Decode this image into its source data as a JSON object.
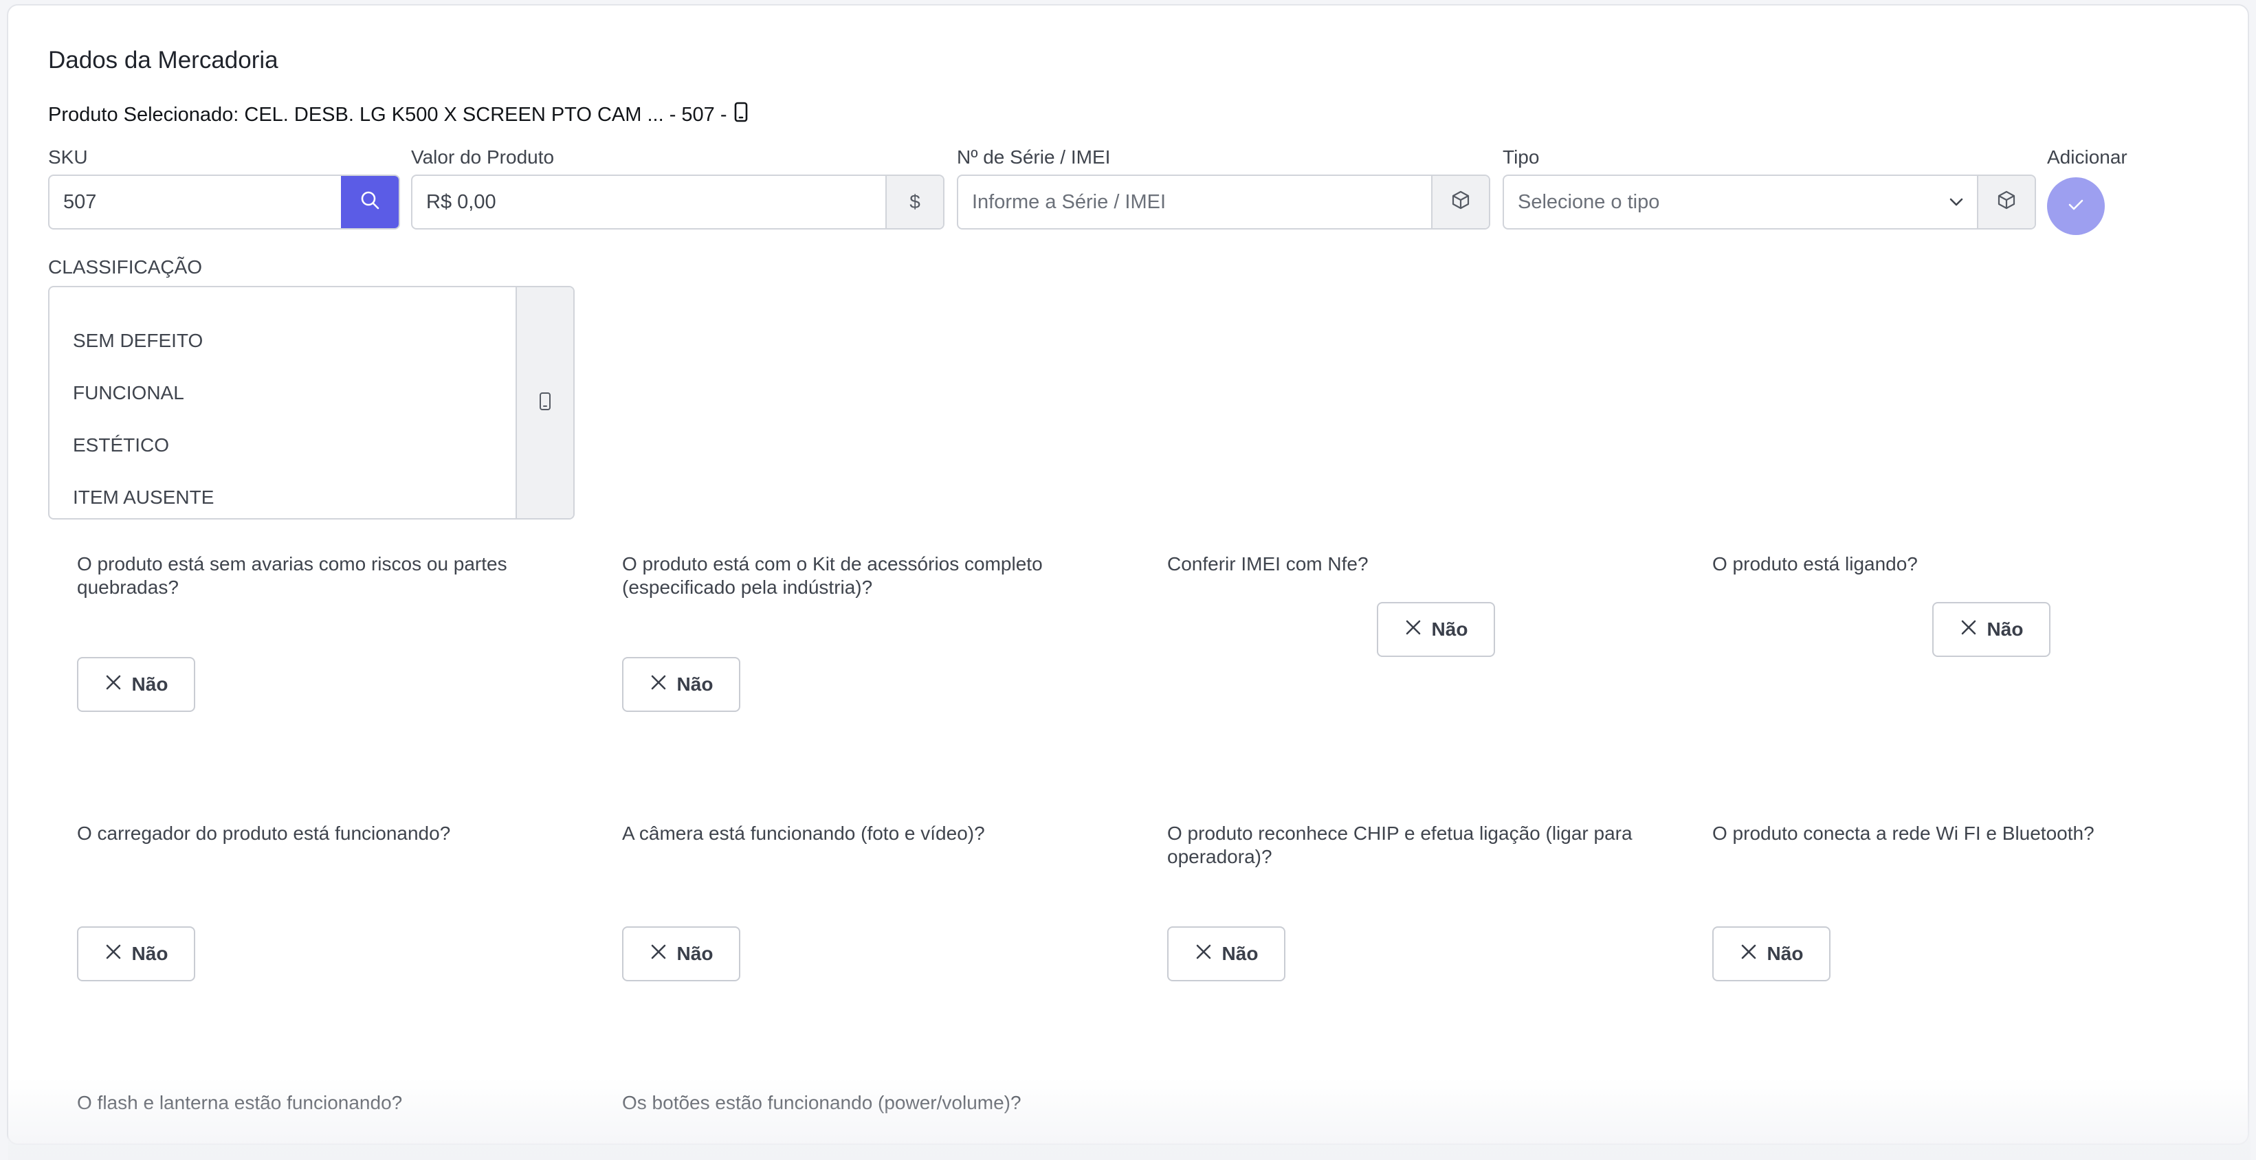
{
  "section_title": "Dados da Mercadoria",
  "selected_product": "Produto Selecionado: CEL. DESB. LG K500 X SCREEN PTO CAM ... - 507 -",
  "sku": {
    "label": "SKU",
    "value": "507"
  },
  "valor": {
    "label": "Valor do Produto",
    "value": "R$ 0,00",
    "addon": "$"
  },
  "serie": {
    "label": "Nº de Série / IMEI",
    "placeholder": "Informe a Série / IMEI"
  },
  "tipo": {
    "label": "Tipo",
    "placeholder": "Selecione o tipo"
  },
  "adicionar": {
    "label": "Adicionar"
  },
  "classificacao": {
    "label": "CLASSIFICAÇÃO",
    "items": [
      "SEM DEFEITO",
      "FUNCIONAL",
      "ESTÉTICO",
      "ITEM AUSENTE"
    ]
  },
  "no_label": "Não",
  "questions": [
    "O produto está sem avarias como riscos ou partes quebradas?",
    "O produto está com o Kit de acessórios completo (especificado pela indústria)?",
    "Conferir IMEI com Nfe?",
    "O produto está ligando?",
    "O carregador do produto está funcionando?",
    "A câmera está funcionando (foto e vídeo)?",
    "O produto reconhece CHIP e efetua ligação (ligar para operadora)?",
    "O produto conecta a rede Wi FI e Bluetooth?",
    "O flash e lanterna estão funcionando?",
    "Os botões estão funcionando (power/volume)?"
  ],
  "colors": {
    "primary": "#5b5ce6",
    "primary_light": "#9d9ff0",
    "border": "#d1d4da",
    "addon_bg": "#f0f1f3"
  }
}
